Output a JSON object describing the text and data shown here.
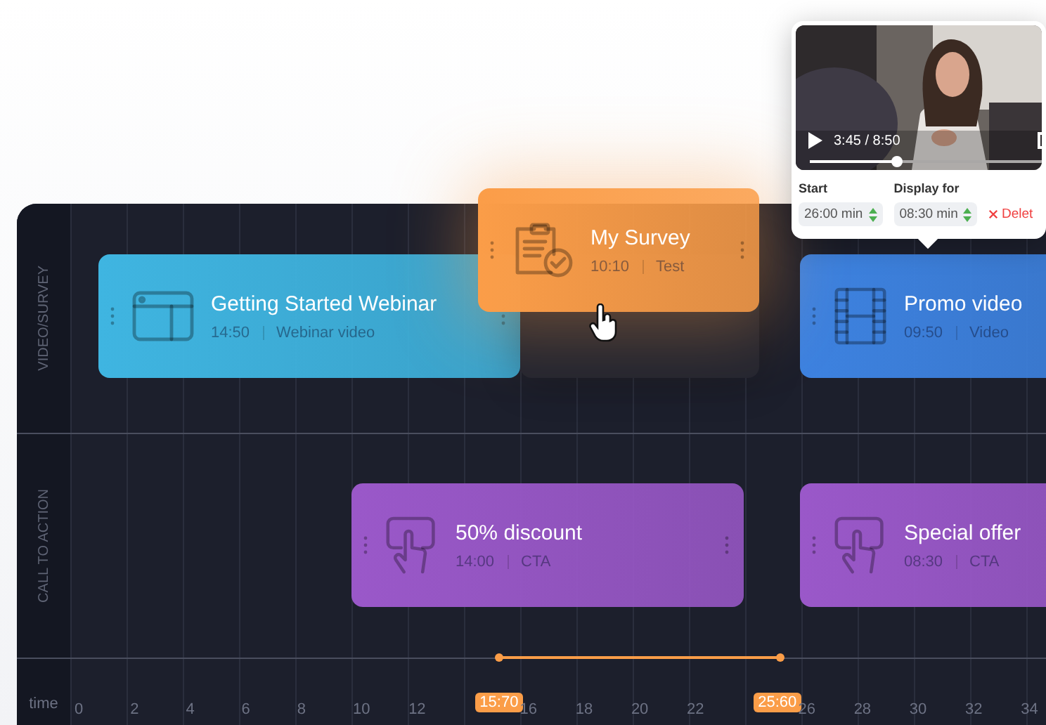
{
  "tracks": [
    {
      "label": "VIDEO/SURVEY",
      "cards": [
        {
          "kind": "webinar",
          "title": "Getting Started Webinar",
          "duration": "14:50",
          "type": "Webinar video",
          "color": "#3fb5e1",
          "dragging": false
        },
        {
          "kind": "survey",
          "title": "My Survey",
          "duration": "10:10",
          "type": "Test",
          "color": "#fb9d48",
          "dragging": true
        },
        {
          "kind": "video",
          "title": "Promo video",
          "duration": "09:50",
          "type": "Video",
          "color": "#3d82e0",
          "dragging": false
        }
      ]
    },
    {
      "label": "CALL TO ACTION",
      "cards": [
        {
          "kind": "cta",
          "title": "50% discount",
          "duration": "14:00",
          "type": "CTA",
          "color": "#9a58c9",
          "dragging": false
        },
        {
          "kind": "cta",
          "title": "Special offer",
          "duration": "08:30",
          "type": "CTA",
          "color": "#9a58c9",
          "dragging": false
        }
      ]
    }
  ],
  "axis": {
    "label": "time",
    "items": [
      {
        "kind": "tick",
        "label": "0"
      },
      {
        "kind": "tick",
        "label": "2"
      },
      {
        "kind": "tick",
        "label": "4"
      },
      {
        "kind": "tick",
        "label": "6"
      },
      {
        "kind": "tick",
        "label": "8"
      },
      {
        "kind": "tick",
        "label": "10"
      },
      {
        "kind": "tick",
        "label": "12"
      },
      {
        "kind": "marker",
        "label": "15:70"
      },
      {
        "kind": "tick",
        "label": "16"
      },
      {
        "kind": "tick",
        "label": "18"
      },
      {
        "kind": "tick",
        "label": "20"
      },
      {
        "kind": "tick",
        "label": "22"
      },
      {
        "kind": "marker",
        "label": "25:60"
      },
      {
        "kind": "tick",
        "label": "26"
      },
      {
        "kind": "tick",
        "label": "28"
      },
      {
        "kind": "tick",
        "label": "30"
      },
      {
        "kind": "tick",
        "label": "32"
      },
      {
        "kind": "tick",
        "label": "34"
      }
    ]
  },
  "popup": {
    "time": "3:45 / 8:50",
    "level": 0.37,
    "start_label": "Start",
    "start_value": "26:00 min",
    "display_label": "Display for",
    "display_value": "08:30 min",
    "delete": "Delet"
  }
}
